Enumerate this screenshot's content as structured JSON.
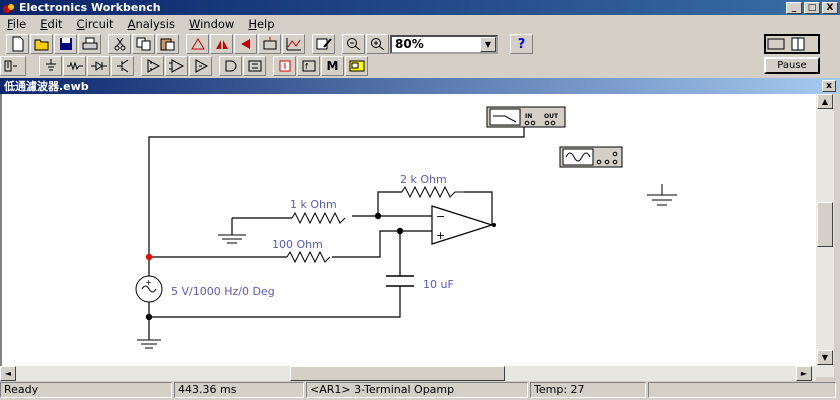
{
  "window": {
    "title": "Electronics Workbench",
    "min_btn": "_",
    "max_btn": "□",
    "close_btn": "X"
  },
  "menu": [
    {
      "label": "File",
      "key": "F",
      "rest": "ile"
    },
    {
      "label": "Edit",
      "key": "E",
      "rest": "dit"
    },
    {
      "label": "Circuit",
      "key": "C",
      "rest": "ircuit"
    },
    {
      "label": "Analysis",
      "key": "A",
      "rest": "nalysis"
    },
    {
      "label": "Window",
      "key": "W",
      "rest": "indow"
    },
    {
      "label": "Help",
      "key": "H",
      "rest": "elp"
    }
  ],
  "toolbar": {
    "zoom_value": "80%",
    "zoom_arrow": "▼",
    "help_label": "?",
    "pause_label": "Pause",
    "menu_label": "M"
  },
  "document": {
    "title": "低通濾波器.ewb",
    "close_btn": "x"
  },
  "circuit": {
    "r_feedback": "2 k Ohm",
    "r_input": "1 k Ohm",
    "r_series": "100  Ohm",
    "source": "5 V/1000 Hz/0 Deg",
    "capacitor": "10 uF",
    "bode_in": "IN",
    "bode_out": "OUT"
  },
  "scroll": {
    "up": "▲",
    "down": "▼",
    "left": "◄",
    "right": "►"
  },
  "status": {
    "state": "Ready",
    "time": "443.36 ms",
    "component": "<AR1> 3-Terminal Opamp",
    "temp": "Temp:  27"
  },
  "colors": {
    "title_bar": "#0a246a",
    "wire": "#000000",
    "label": "#5a5ab4",
    "node_red": "#ff0000"
  }
}
